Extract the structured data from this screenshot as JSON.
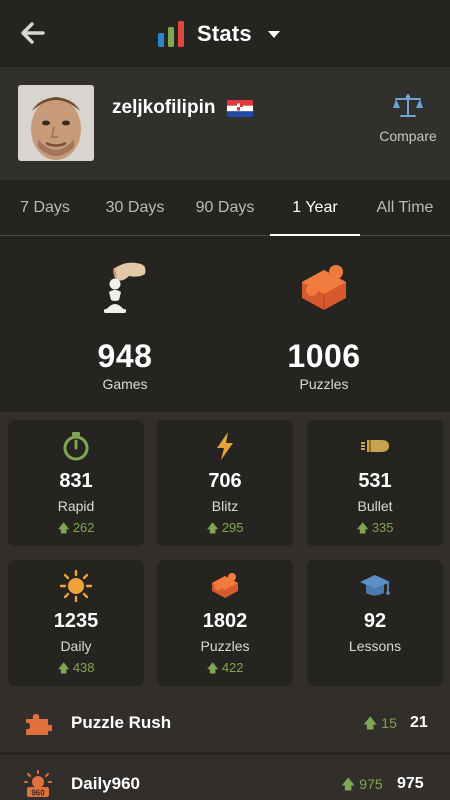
{
  "header": {
    "title": "Stats",
    "back_icon": "arrow-left-icon",
    "stats_icon": "bar-chart-icon",
    "caret_icon": "caret-down-icon"
  },
  "profile": {
    "username": "zeljkofilipin",
    "country_flag": "croatia-flag",
    "compare_label": "Compare"
  },
  "tabs": [
    {
      "label": "7 Days",
      "active": false
    },
    {
      "label": "30 Days",
      "active": false
    },
    {
      "label": "90 Days",
      "active": false
    },
    {
      "label": "1 Year",
      "active": true
    },
    {
      "label": "All Time",
      "active": false
    }
  ],
  "summary": {
    "games": {
      "value": "948",
      "label": "Games",
      "icon": "pawn-hand-icon"
    },
    "puzzles": {
      "value": "1006",
      "label": "Puzzles",
      "icon": "puzzle-piece-icon"
    }
  },
  "cards": [
    {
      "value": "831",
      "label": "Rapid",
      "change": "262",
      "icon": "stopwatch-icon"
    },
    {
      "value": "706",
      "label": "Blitz",
      "change": "295",
      "icon": "lightning-icon"
    },
    {
      "value": "531",
      "label": "Bullet",
      "change": "335",
      "icon": "bullet-icon"
    },
    {
      "value": "1235",
      "label": "Daily",
      "change": "438",
      "icon": "sun-icon"
    },
    {
      "value": "1802",
      "label": "Puzzles",
      "change": "422",
      "icon": "puzzle-icon"
    },
    {
      "value": "92",
      "label": "Lessons",
      "change": "",
      "icon": "graduation-cap-icon"
    }
  ],
  "rows": [
    {
      "label": "Puzzle Rush",
      "change": "15",
      "value": "21",
      "icon": "puzzle-rush-icon"
    },
    {
      "label": "Daily960",
      "change": "975",
      "value": "975",
      "icon": "daily960-icon"
    }
  ],
  "colors": {
    "background": "#262421",
    "panel": "#312e2b",
    "positive": "#7fa650",
    "accent_orange": "#e58f2a"
  }
}
